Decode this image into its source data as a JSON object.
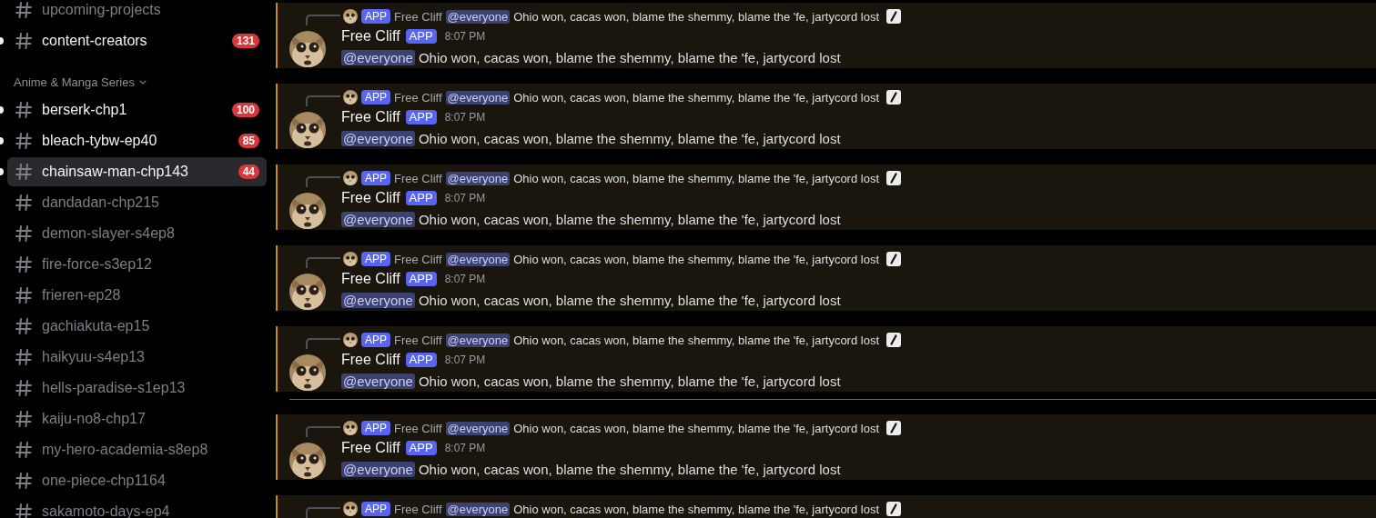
{
  "sidebar": {
    "items": [
      {
        "kind": "channel",
        "name": "upcoming-projects",
        "unread": false,
        "selected": false
      },
      {
        "kind": "channel",
        "name": "content-creators",
        "unread": true,
        "badge": "131",
        "selected": false
      },
      {
        "kind": "category",
        "label": "Anime & Manga Series"
      },
      {
        "kind": "channel",
        "name": "berserk-chp1",
        "unread": true,
        "badge": "100",
        "selected": false
      },
      {
        "kind": "channel",
        "name": "bleach-tybw-ep40",
        "unread": true,
        "badge": "85",
        "selected": false
      },
      {
        "kind": "channel",
        "name": "chainsaw-man-chp143",
        "unread": true,
        "badge": "44",
        "selected": true
      },
      {
        "kind": "channel",
        "name": "dandadan-chp215",
        "unread": false,
        "selected": false
      },
      {
        "kind": "channel",
        "name": "demon-slayer-s4ep8",
        "unread": false,
        "selected": false
      },
      {
        "kind": "channel",
        "name": "fire-force-s3ep12",
        "unread": false,
        "selected": false
      },
      {
        "kind": "channel",
        "name": "frieren-ep28",
        "unread": false,
        "selected": false
      },
      {
        "kind": "channel",
        "name": "gachiakuta-ep15",
        "unread": false,
        "selected": false
      },
      {
        "kind": "channel",
        "name": "haikyuu-s4ep13",
        "unread": false,
        "selected": false
      },
      {
        "kind": "channel",
        "name": "hells-paradise-s1ep13",
        "unread": false,
        "selected": false
      },
      {
        "kind": "channel",
        "name": "kaiju-no8-chp17",
        "unread": false,
        "selected": false
      },
      {
        "kind": "channel",
        "name": "my-hero-academia-s8ep8",
        "unread": false,
        "selected": false
      },
      {
        "kind": "channel",
        "name": "one-piece-chp1164",
        "unread": false,
        "selected": false
      },
      {
        "kind": "channel",
        "name": "sakamoto-days-ep4",
        "unread": false,
        "selected": false
      }
    ]
  },
  "messages": [
    {
      "kind": "message",
      "reply": {
        "author": "Free Cliff",
        "badge": "APP",
        "mention": "@everyone",
        "text": "Ohio won, cacas won, blame the shemmy, blame the 'fe, jartycord lost"
      },
      "author": "Free Cliff",
      "badge": "APP",
      "time": "8:07 PM",
      "mention": "@everyone",
      "text": "Ohio won, cacas won, blame the shemmy, blame the 'fe, jartycord lost"
    },
    {
      "kind": "message",
      "reply": {
        "author": "Free Cliff",
        "badge": "APP",
        "mention": "@everyone",
        "text": "Ohio won, cacas won, blame the shemmy, blame the 'fe, jartycord lost"
      },
      "author": "Free Cliff",
      "badge": "APP",
      "time": "8:07 PM",
      "mention": "@everyone",
      "text": "Ohio won, cacas won, blame the shemmy, blame the 'fe, jartycord lost"
    },
    {
      "kind": "message",
      "reply": {
        "author": "Free Cliff",
        "badge": "APP",
        "mention": "@everyone",
        "text": "Ohio won, cacas won, blame the shemmy, blame the 'fe, jartycord lost"
      },
      "author": "Free Cliff",
      "badge": "APP",
      "time": "8:07 PM",
      "mention": "@everyone",
      "text": "Ohio won, cacas won, blame the shemmy, blame the 'fe, jartycord lost"
    },
    {
      "kind": "message",
      "reply": {
        "author": "Free Cliff",
        "badge": "APP",
        "mention": "@everyone",
        "text": "Ohio won, cacas won, blame the shemmy, blame the 'fe, jartycord lost"
      },
      "author": "Free Cliff",
      "badge": "APP",
      "time": "8:07 PM",
      "mention": "@everyone",
      "text": "Ohio won, cacas won, blame the shemmy, blame the 'fe, jartycord lost"
    },
    {
      "kind": "message",
      "reply": {
        "author": "Free Cliff",
        "badge": "APP",
        "mention": "@everyone",
        "text": "Ohio won, cacas won, blame the shemmy, blame the 'fe, jartycord lost"
      },
      "author": "Free Cliff",
      "badge": "APP",
      "time": "8:07 PM",
      "mention": "@everyone",
      "text": "Ohio won, cacas won, blame the shemmy, blame the 'fe, jartycord lost"
    },
    {
      "kind": "divider"
    },
    {
      "kind": "message",
      "reply": {
        "author": "Free Cliff",
        "badge": "APP",
        "mention": "@everyone",
        "text": "Ohio won, cacas won, blame the shemmy, blame the 'fe, jartycord lost"
      },
      "author": "Free Cliff",
      "badge": "APP",
      "time": "8:07 PM",
      "mention": "@everyone",
      "text": "Ohio won, cacas won, blame the shemmy, blame the 'fe, jartycord lost"
    },
    {
      "kind": "message",
      "reply": {
        "author": "Free Cliff",
        "badge": "APP",
        "mention": "@everyone",
        "text": "Ohio won, cacas won, blame the shemmy, blame the 'fe, jartycord lost"
      }
    }
  ]
}
